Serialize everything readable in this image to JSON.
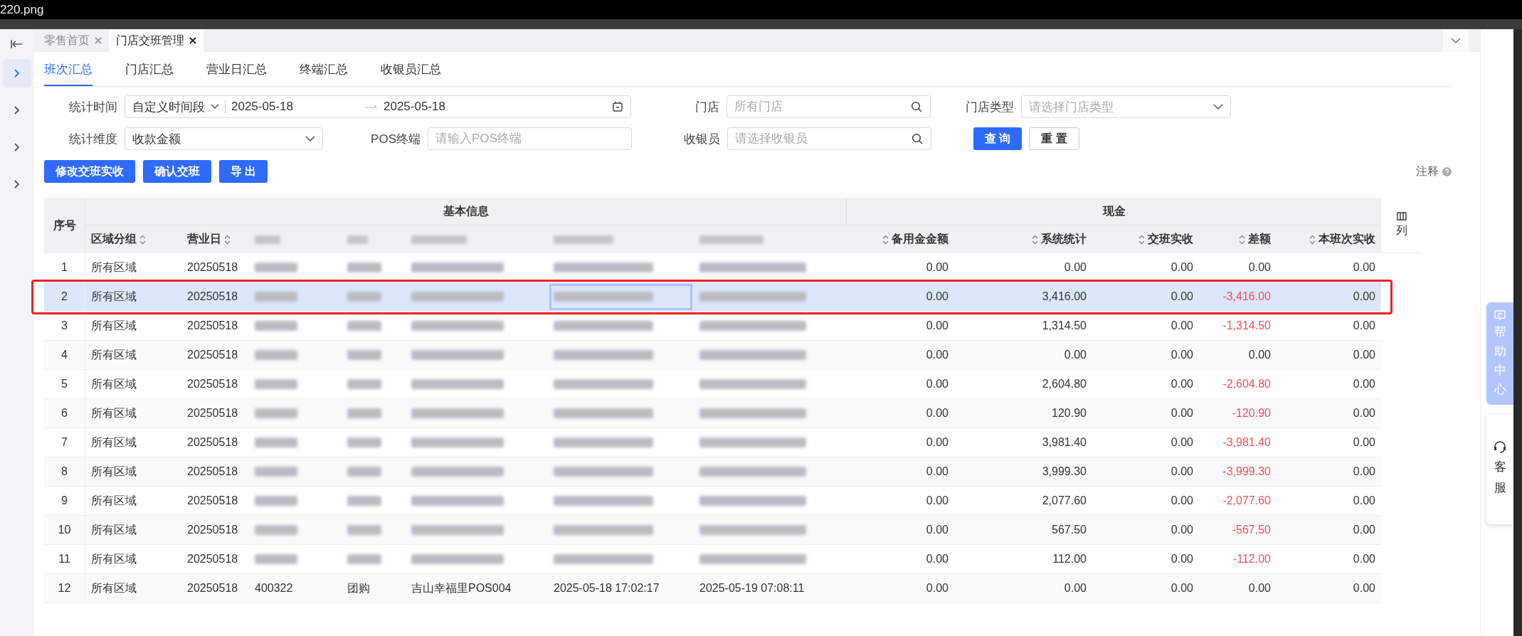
{
  "window": {
    "title": "220.png"
  },
  "page_tabs": [
    {
      "label": "零售首页",
      "selected": false
    },
    {
      "label": "门店交班管理",
      "selected": true
    }
  ],
  "sidebar": {
    "items": [
      {
        "selected": true
      },
      {
        "selected": false
      },
      {
        "selected": false
      },
      {
        "selected": false
      }
    ]
  },
  "tabs": [
    {
      "label": "班次汇总",
      "selected": true
    },
    {
      "label": "门店汇总",
      "selected": false
    },
    {
      "label": "营业日汇总",
      "selected": false
    },
    {
      "label": "终端汇总",
      "selected": false
    },
    {
      "label": "收银员汇总",
      "selected": false
    }
  ],
  "filters": {
    "time": {
      "label": "统计时间",
      "mode": "自定义时间段",
      "start": "2025-05-18",
      "end": "2025-05-18"
    },
    "store": {
      "label": "门店",
      "placeholder": "所有门店"
    },
    "store_type": {
      "label": "门店类型",
      "placeholder": "请选择门店类型"
    },
    "dimension": {
      "label": "统计维度",
      "value": "收款金额"
    },
    "pos": {
      "label": "POS终端",
      "placeholder": "请输入POS终端"
    },
    "cashier": {
      "label": "收银员",
      "placeholder": "请选择收银员"
    },
    "query_button": "查 询",
    "reset_button": "重 置"
  },
  "actions": [
    "修改交班实收",
    "确认交班",
    "导 出"
  ],
  "note": "注释",
  "table": {
    "seq_header": "序号",
    "group_basic": "基本信息",
    "group_cash": "现金",
    "columns_settings": "列",
    "columns": [
      {
        "label": "区域分组",
        "sortable": true
      },
      {
        "label": "营业日",
        "sortable": true
      }
    ],
    "cash_columns": [
      {
        "label": "备用金金额"
      },
      {
        "label": "系统统计"
      },
      {
        "label": "交班实收"
      },
      {
        "label": "差额"
      },
      {
        "label": "本班次实收"
      }
    ],
    "rows": [
      {
        "seq": "1",
        "region": "所有区域",
        "date": "20250518",
        "redacted": true,
        "selected": false,
        "annotated": false,
        "cash": [
          "0.00",
          "0.00",
          "0.00",
          "0.00",
          "0.00"
        ],
        "diff_negative": false
      },
      {
        "seq": "2",
        "region": "所有区域",
        "date": "20250518",
        "redacted": true,
        "selected": true,
        "annotated": true,
        "cash": [
          "0.00",
          "3,416.00",
          "0.00",
          "-3,416.00",
          "0.00"
        ],
        "diff_negative": true
      },
      {
        "seq": "3",
        "region": "所有区域",
        "date": "20250518",
        "redacted": true,
        "selected": false,
        "annotated": false,
        "cash": [
          "0.00",
          "1,314.50",
          "0.00",
          "-1,314.50",
          "0.00"
        ],
        "diff_negative": true
      },
      {
        "seq": "4",
        "region": "所有区域",
        "date": "20250518",
        "redacted": true,
        "selected": false,
        "annotated": false,
        "cash": [
          "0.00",
          "0.00",
          "0.00",
          "0.00",
          "0.00"
        ],
        "diff_negative": false
      },
      {
        "seq": "5",
        "region": "所有区域",
        "date": "20250518",
        "redacted": true,
        "selected": false,
        "annotated": false,
        "cash": [
          "0.00",
          "2,604.80",
          "0.00",
          "-2,604.80",
          "0.00"
        ],
        "diff_negative": true
      },
      {
        "seq": "6",
        "region": "所有区域",
        "date": "20250518",
        "redacted": true,
        "selected": false,
        "annotated": false,
        "cash": [
          "0.00",
          "120.90",
          "0.00",
          "-120.90",
          "0.00"
        ],
        "diff_negative": true
      },
      {
        "seq": "7",
        "region": "所有区域",
        "date": "20250518",
        "redacted": true,
        "selected": false,
        "annotated": false,
        "cash": [
          "0.00",
          "3,981.40",
          "0.00",
          "-3,981.40",
          "0.00"
        ],
        "diff_negative": true
      },
      {
        "seq": "8",
        "region": "所有区域",
        "date": "20250518",
        "redacted": true,
        "selected": false,
        "annotated": false,
        "cash": [
          "0.00",
          "3,999.30",
          "0.00",
          "-3,999.30",
          "0.00"
        ],
        "diff_negative": true
      },
      {
        "seq": "9",
        "region": "所有区域",
        "date": "20250518",
        "redacted": true,
        "selected": false,
        "annotated": false,
        "cash": [
          "0.00",
          "2,077.60",
          "0.00",
          "-2,077.60",
          "0.00"
        ],
        "diff_negative": true
      },
      {
        "seq": "10",
        "region": "所有区域",
        "date": "20250518",
        "redacted": true,
        "selected": false,
        "annotated": false,
        "cash": [
          "0.00",
          "567.50",
          "0.00",
          "-567.50",
          "0.00"
        ],
        "diff_negative": true
      },
      {
        "seq": "11",
        "region": "所有区域",
        "date": "20250518",
        "redacted": true,
        "selected": false,
        "annotated": false,
        "cash": [
          "0.00",
          "112.00",
          "0.00",
          "-112.00",
          "0.00"
        ],
        "diff_negative": true
      },
      {
        "seq": "12",
        "region": "所有区域",
        "date": "20250518",
        "redacted": false,
        "selected": false,
        "annotated": false,
        "basic": [
          "400322",
          "团购",
          "吉山幸福里POS004",
          "2025-05-18 17:02:17",
          "2025-05-19 07:08:11"
        ],
        "cash": [
          "0.00",
          "0.00",
          "0.00",
          "0.00",
          "0.00"
        ],
        "diff_negative": false
      }
    ]
  },
  "side_widgets": {
    "help": "帮助中心",
    "service": "客服"
  }
}
